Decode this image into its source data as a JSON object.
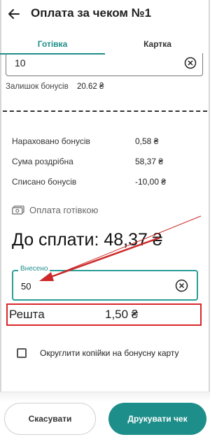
{
  "header": {
    "title": "Оплата за чеком №1",
    "back_icon": "arrow-left-icon"
  },
  "tabs": [
    {
      "label": "Готівка",
      "active": true
    },
    {
      "label": "Картка",
      "active": false
    }
  ],
  "bonus_field": {
    "value": "10",
    "clear_icon": "clear-circle-icon"
  },
  "bonus_balance": {
    "label": "Залишок бонусів",
    "value": "20.62 ₴"
  },
  "summary": [
    {
      "label": "Нараховано бонусів",
      "value": "0,58 ₴"
    },
    {
      "label": "Сума роздрібна",
      "value": "58,37 ₴"
    },
    {
      "label": "Списано бонусів",
      "value": "-10,00 ₴"
    }
  ],
  "cash": {
    "label": "Оплата готівкою",
    "icon": "cash-icon"
  },
  "to_pay": "До сплати: 48,37 ₴",
  "received_input": {
    "label": "Внесено",
    "value": "50",
    "clear_icon": "clear-circle-icon"
  },
  "change": {
    "label": "Решта",
    "value": "1,50 ₴"
  },
  "round_option": {
    "label": "Округлити копійки на бонусну карту",
    "checked": false
  },
  "buttons": {
    "cancel": "Скасувати",
    "print": "Друкувати чек"
  },
  "colors": {
    "accent": "#1e8e8a",
    "highlight": "#d9262b"
  }
}
